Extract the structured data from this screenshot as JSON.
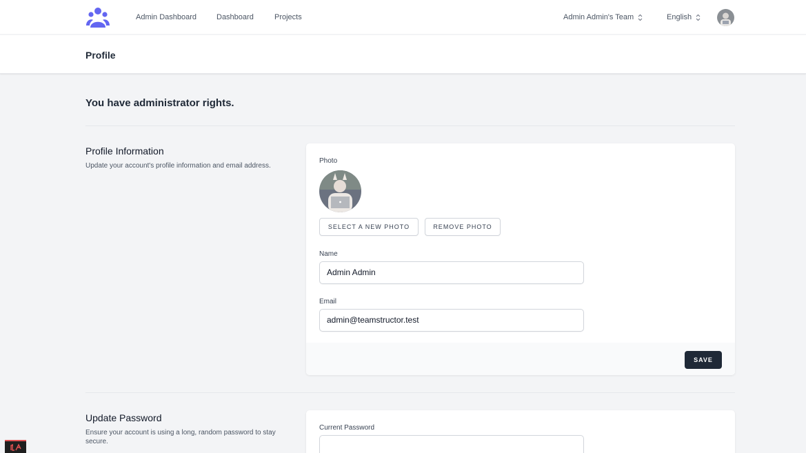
{
  "nav": {
    "links": [
      "Admin Dashboard",
      "Dashboard",
      "Projects"
    ],
    "team_switcher": "Admin Admin's Team",
    "language": "English"
  },
  "header": {
    "title": "Profile"
  },
  "admin_notice": "You have administrator rights.",
  "profile_info": {
    "title": "Profile Information",
    "description": "Update your account's profile information and email address.",
    "photo_label": "Photo",
    "select_photo_button": "SELECT A NEW PHOTO",
    "remove_photo_button": "REMOVE PHOTO",
    "name_label": "Name",
    "name_value": "Admin Admin",
    "email_label": "Email",
    "email_value": "admin@teamstructor.test",
    "save_button": "SAVE"
  },
  "update_password": {
    "title": "Update Password",
    "description": "Ensure your account is using a long, random password to stay secure.",
    "current_password_label": "Current Password"
  },
  "colors": {
    "brand": "#6366f1",
    "primary_button": "#1f2937"
  }
}
